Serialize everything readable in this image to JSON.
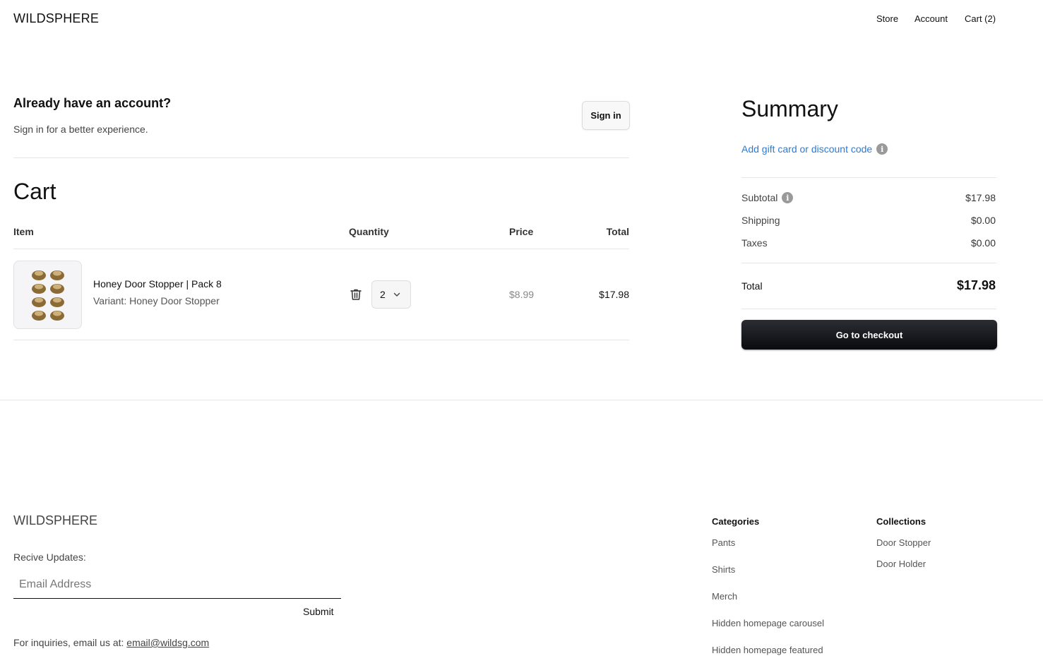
{
  "header": {
    "brand": "WILDSPHERE",
    "nav": {
      "store": "Store",
      "account": "Account",
      "cart": "Cart (2)"
    }
  },
  "signin": {
    "title": "Already have an account?",
    "subtitle": "Sign in for a better experience.",
    "button": "Sign in"
  },
  "cart": {
    "title": "Cart",
    "columns": {
      "item": "Item",
      "quantity": "Quantity",
      "price": "Price",
      "total": "Total"
    },
    "items": [
      {
        "name": "Honey Door Stopper | Pack 8",
        "variant": "Variant: Honey Door Stopper",
        "quantity": "2",
        "unit_price": "$8.99",
        "line_total": "$17.98"
      }
    ]
  },
  "summary": {
    "title": "Summary",
    "gift_link": "Add gift card or discount code",
    "subtotal_label": "Subtotal",
    "subtotal": "$17.98",
    "shipping_label": "Shipping",
    "shipping": "$0.00",
    "taxes_label": "Taxes",
    "taxes": "$0.00",
    "total_label": "Total",
    "total": "$17.98",
    "checkout": "Go to checkout"
  },
  "footer": {
    "brand": "WILDSPHERE",
    "updates_label": "Recive Updates:",
    "email_placeholder": "Email Address",
    "submit": "Submit",
    "inquiry_text": "For inquiries, email us at: ",
    "inquiry_email": "email@wildsg.com",
    "categories": {
      "heading": "Categories",
      "links": [
        "Pants",
        "Shirts",
        "Merch",
        "Hidden homepage carousel",
        "Hidden homepage featured"
      ]
    },
    "collections": {
      "heading": "Collections",
      "links": [
        "Door Stopper",
        "Door Holder"
      ]
    }
  },
  "colors": {
    "link_blue": "#2b7bd5",
    "button_dark": "#0a0b0f",
    "divider": "#e6e6e6"
  },
  "icons": [
    "trash-icon",
    "chevron-down-icon",
    "info-icon"
  ]
}
